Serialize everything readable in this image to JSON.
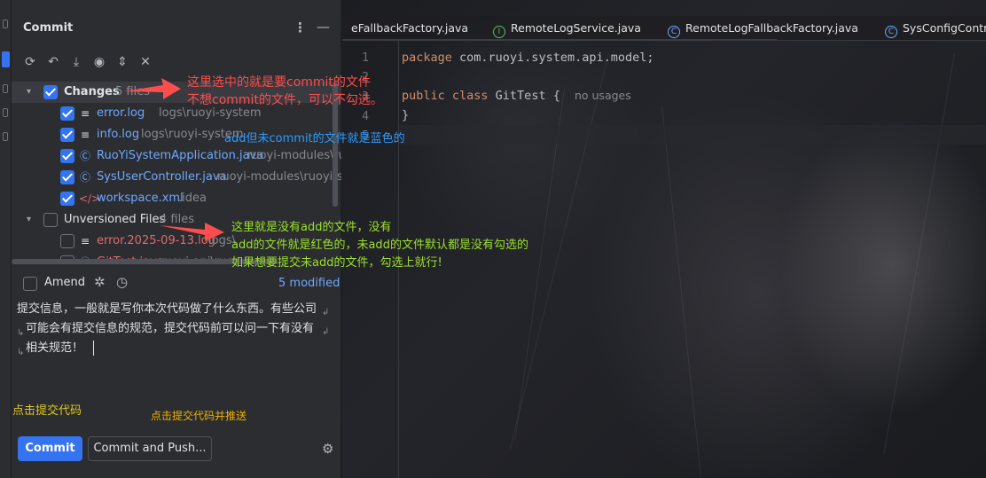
{
  "panel": {
    "title": "Commit",
    "more_icon": "more-vertical-icon",
    "minimize_icon": "minimize-icon"
  },
  "toolbar": {
    "icons": [
      "refresh-icon",
      "rollback-icon",
      "download-icon",
      "eye-icon",
      "expand-icon",
      "collapse-icon"
    ]
  },
  "changes": {
    "label": "Changes",
    "count": "5 files",
    "files": [
      {
        "name": "error.log",
        "path": "logs\\ruoyi-system",
        "icon": "text-file-icon",
        "color": "#6fa8ff"
      },
      {
        "name": "info.log",
        "path": "logs\\ruoyi-system",
        "icon": "text-file-icon",
        "color": "#6fa8ff"
      },
      {
        "name": "RuoYiSystemApplication.java",
        "path": "ruoyi-modules\\ruo",
        "icon": "java-class-icon",
        "color": "#6fa8ff"
      },
      {
        "name": "SysUserController.java",
        "path": "ruoyi-modules\\ruoyi-sys",
        "icon": "java-class-icon",
        "color": "#6fa8ff"
      },
      {
        "name": "workspace.xml",
        "path": ".idea",
        "icon": "xml-file-icon",
        "color": "#6fa8ff"
      }
    ]
  },
  "unversioned": {
    "label": "Unversioned Files",
    "count": "4 files",
    "files": [
      {
        "name": "error.2025-09-13.log",
        "path": "logs\\",
        "icon": "text-file-icon",
        "color": "#e06c6c"
      },
      {
        "name": "GitTest.java",
        "path": "ruoyi-api\\ruoy",
        "icon": "java-class-icon",
        "color": "#e06c6c"
      }
    ]
  },
  "amend": {
    "label": "Amend",
    "modified": "5 modified"
  },
  "message": {
    "lines": [
      "提交信息，一般就是写你本次代码做了什么东西。有些公司",
      "可能会有提交信息的规范，提交代码前可以问一下有没有",
      "相关规范！"
    ]
  },
  "buttons": {
    "commit": "Commit",
    "commit_push": "Commit and Push..."
  },
  "editor": {
    "tabs": [
      {
        "label": "eFallbackFactory.java",
        "icon": ""
      },
      {
        "label": "RemoteLogService.java",
        "icon": "I"
      },
      {
        "label": "RemoteLogFallbackFactory.java",
        "icon": "C"
      },
      {
        "label": "SysConfigContro",
        "icon": "C"
      }
    ],
    "line_numbers": [
      "1",
      "2",
      "3",
      "4",
      "5"
    ],
    "code": {
      "line1_kw": "package",
      "line1_rest": " com.ruoyi.system.api.model;",
      "line3_kw": "public class",
      "line3_name": " GitTest {",
      "line3_hint": "no usages",
      "line4": "}"
    }
  },
  "annotations": {
    "a1_line1": "这里选中的就是要commit的文件",
    "a1_line2": "不想commit的文件，可以不勾选。",
    "a2": "add但未commit的文件就是蓝色的",
    "a3_line1": "这里就是没有add的文件，没有",
    "a3_line2": "add的文件就是红色的，未add的文件默认都是没有勾选的",
    "a3_line3": "如果想要提交未add的文件，勾选上就行!",
    "a4": "点击提交代码",
    "a5": "点击提交代码并推送"
  },
  "colors": {
    "accent": "#3574f0",
    "added_file": "#6fa8ff",
    "unversioned_file": "#e06c6c",
    "annotation_red": "#ff4d4d",
    "annotation_blue": "#2e9bff",
    "annotation_green": "#9ae02a",
    "annotation_yellow": "#e3c81c"
  }
}
